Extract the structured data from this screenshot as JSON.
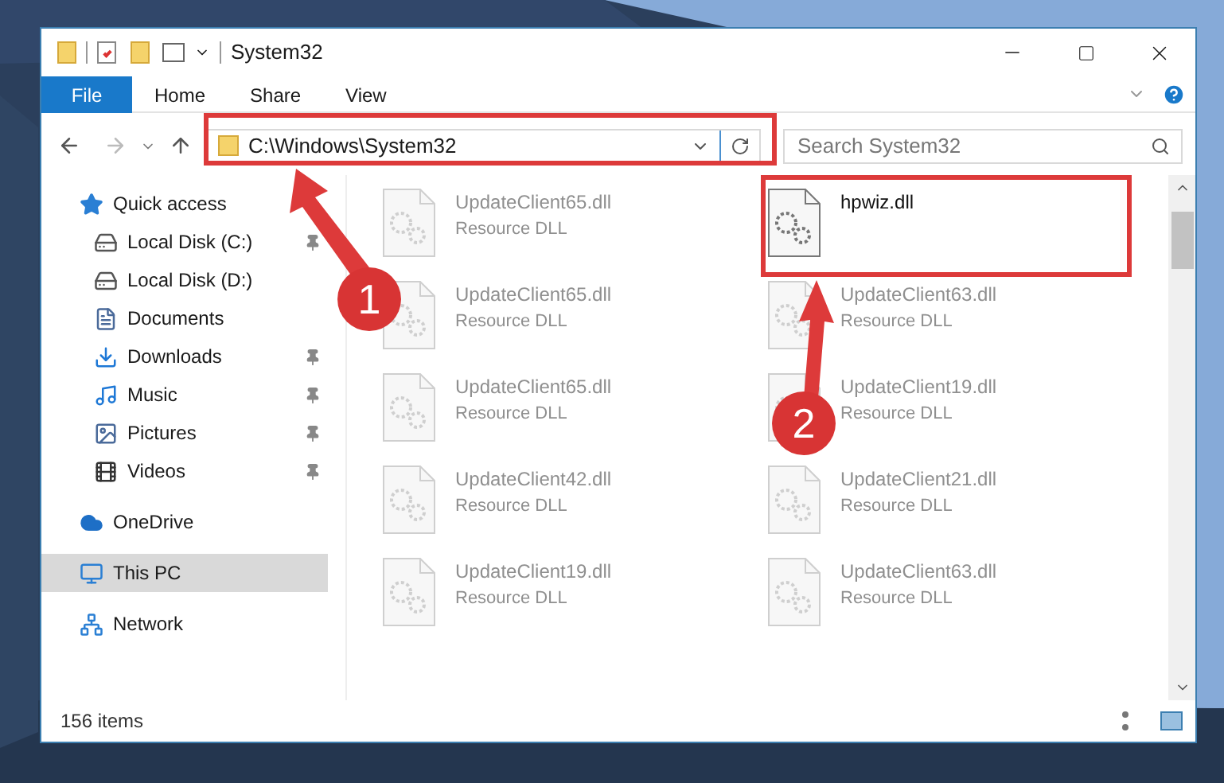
{
  "window": {
    "title": "System32"
  },
  "ribbon_tabs": [
    {
      "label": "File",
      "selected": true
    },
    {
      "label": "Home",
      "selected": false
    },
    {
      "label": "Share",
      "selected": false
    },
    {
      "label": "View",
      "selected": false
    }
  ],
  "address": {
    "path": "C:\\Windows\\System32"
  },
  "search": {
    "placeholder": "Search System32"
  },
  "sidebar": {
    "items": [
      {
        "label": "Quick access",
        "kind": "star",
        "selected": false,
        "children": [
          {
            "label": "Local Disk (C:)",
            "kind": "disk",
            "pinned": true,
            "selected": false
          },
          {
            "label": "Local Disk (D:)",
            "kind": "disk",
            "pinned": false,
            "selected": false
          },
          {
            "label": "Documents",
            "kind": "document",
            "pinned": false,
            "selected": false
          },
          {
            "label": "Downloads",
            "kind": "download",
            "pinned": true,
            "selected": false
          },
          {
            "label": "Music",
            "kind": "music",
            "pinned": true,
            "selected": false
          },
          {
            "label": "Pictures",
            "kind": "pictures",
            "pinned": true,
            "selected": false
          },
          {
            "label": "Videos",
            "kind": "video",
            "pinned": true,
            "selected": false
          }
        ]
      },
      {
        "label": "OneDrive",
        "kind": "cloud",
        "selected": false
      },
      {
        "label": "This PC",
        "kind": "pc",
        "selected": true
      },
      {
        "label": "Network",
        "kind": "network",
        "selected": false
      }
    ]
  },
  "files": [
    {
      "name": "UpdateClient65.dll",
      "type": "Resource DLL",
      "faded": true
    },
    {
      "name": "hpwiz.dll",
      "faded": false
    },
    {
      "name": "UpdateClient65.dll",
      "type": "Resource DLL",
      "faded": true
    },
    {
      "name": "UpdateClient63.dll",
      "type": "Resource DLL",
      "faded": true
    },
    {
      "name": "UpdateClient65.dll",
      "type": "Resource DLL",
      "faded": true
    },
    {
      "name": "UpdateClient19.dll",
      "type": "Resource DLL",
      "faded": true
    },
    {
      "name": "UpdateClient42.dll",
      "type": "Resource DLL",
      "faded": true
    },
    {
      "name": "UpdateClient21.dll",
      "type": "Resource DLL",
      "faded": true
    },
    {
      "name": "UpdateClient19.dll",
      "type": "Resource DLL",
      "faded": true
    },
    {
      "name": "UpdateClient63.dll",
      "type": "Resource DLL",
      "faded": true
    }
  ],
  "status_bar": {
    "item_count": "156 items"
  },
  "annotations": [
    {
      "label": "1"
    },
    {
      "label": "2"
    }
  ]
}
